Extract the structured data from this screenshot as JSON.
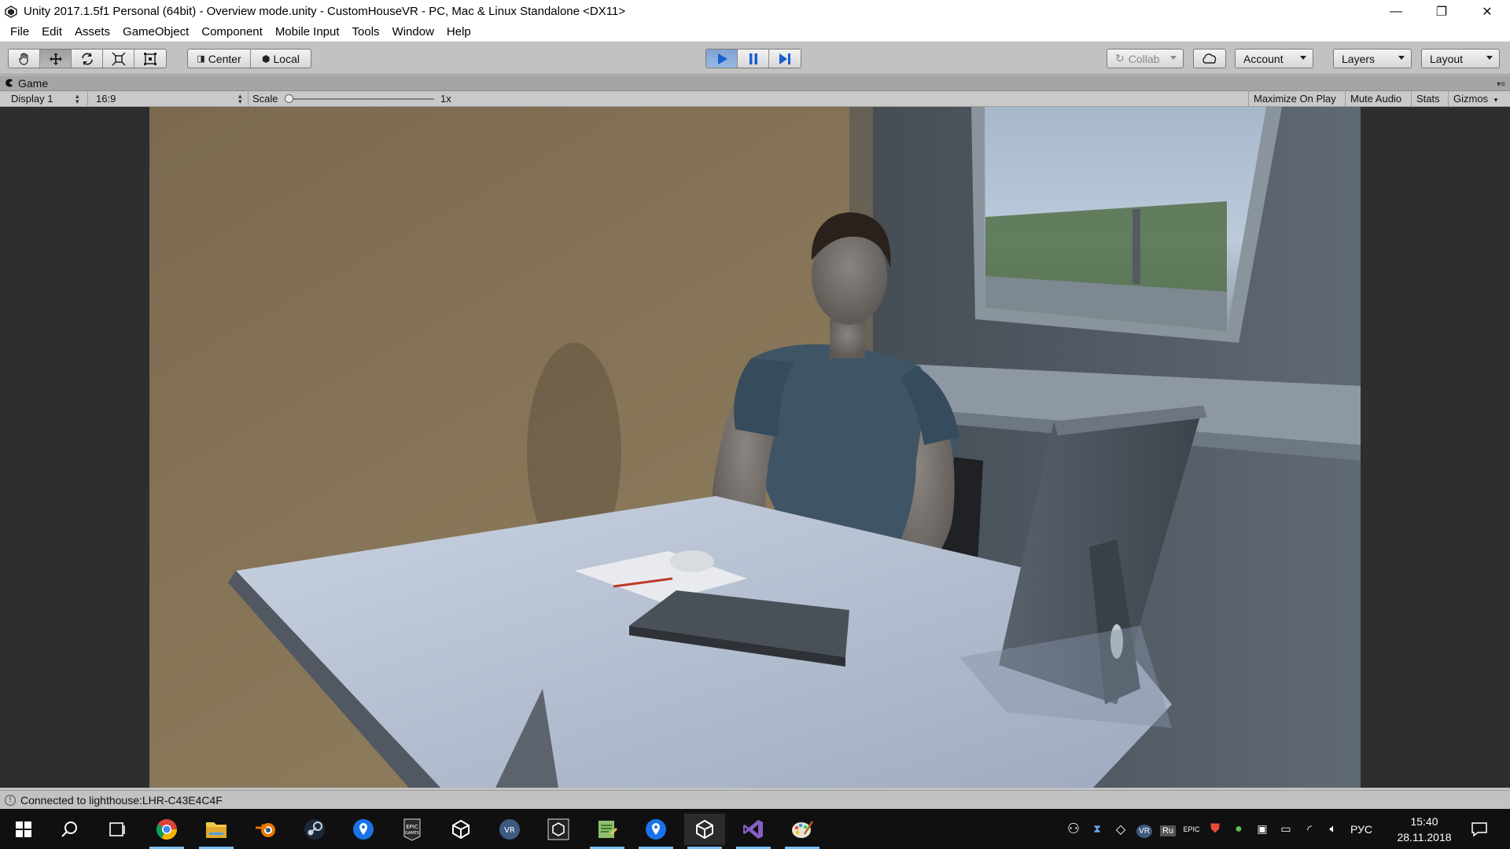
{
  "window": {
    "title": "Unity 2017.1.5f1 Personal (64bit) - Overview mode.unity - CustomHouseVR - PC, Mac & Linux Standalone <DX11>",
    "minimize": "—",
    "maximize": "❐",
    "close": "✕"
  },
  "menu": {
    "items": [
      "File",
      "Edit",
      "Assets",
      "GameObject",
      "Component",
      "Mobile Input",
      "Tools",
      "Window",
      "Help"
    ]
  },
  "toolbar": {
    "pivot_center": "Center",
    "pivot_local": "Local",
    "collab": "Collab",
    "account": "Account",
    "layers": "Layers",
    "layout": "Layout"
  },
  "game_tab": {
    "label": "Game"
  },
  "game_view": {
    "display": "Display 1",
    "aspect": "16:9",
    "scale_label": "Scale",
    "scale_value": "1x",
    "scale_level": 0.0,
    "maximize_on_play": "Maximize On Play",
    "mute_audio": "Mute Audio",
    "stats": "Stats",
    "gizmos": "Gizmos"
  },
  "status": {
    "message": "Connected to lighthouse:LHR-C43E4C4F"
  },
  "taskbar": {
    "apps": [
      "start",
      "search",
      "task-view",
      "chrome",
      "file-explorer",
      "blender",
      "steam",
      "maps-pin",
      "epic-games",
      "unity-hub",
      "vr-app",
      "unity-editor-2",
      "notepad-app",
      "maps-pin-2",
      "unity-active",
      "visual-studio",
      "paint-app"
    ],
    "tray_lang": "РУС",
    "tray_ru": "Ru",
    "tray_vr": "VR",
    "time": "15:40",
    "date": "28.11.2018"
  },
  "colors": {
    "play_active": "#7fa3d1",
    "wall_left": "#8c7a5c",
    "wall_right": "#55606a",
    "desk": "#b8c3d4",
    "shirt": "#3f5566"
  }
}
